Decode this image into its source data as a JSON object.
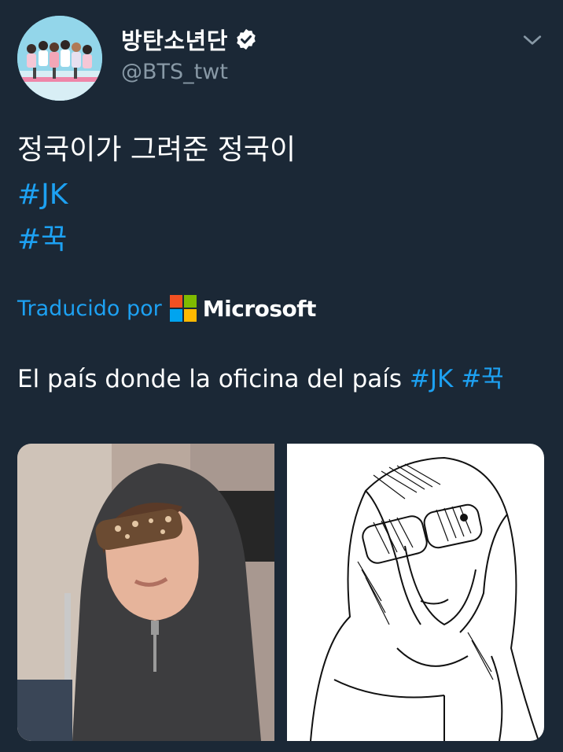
{
  "user": {
    "display_name": "방탄소년단",
    "handle": "@BTS_twt",
    "verified": true,
    "avatar_icon": "avatar"
  },
  "tweet": {
    "text_line": "정국이가 그려준 정국이",
    "hashtags": [
      "#JK",
      "#꾹"
    ]
  },
  "translation": {
    "label": "Traducido por",
    "provider": "Microsoft",
    "text": "El país donde la oficina del país ",
    "hashtags": [
      "#JK",
      "#꾹"
    ]
  },
  "colors": {
    "background": "#1b2836",
    "accent": "#1da1f2",
    "secondary_text": "#8899a6",
    "microsoft": [
      "#f25022",
      "#7fba00",
      "#00a4ef",
      "#ffb900"
    ]
  },
  "media": {
    "items": [
      "photo",
      "drawing"
    ]
  }
}
